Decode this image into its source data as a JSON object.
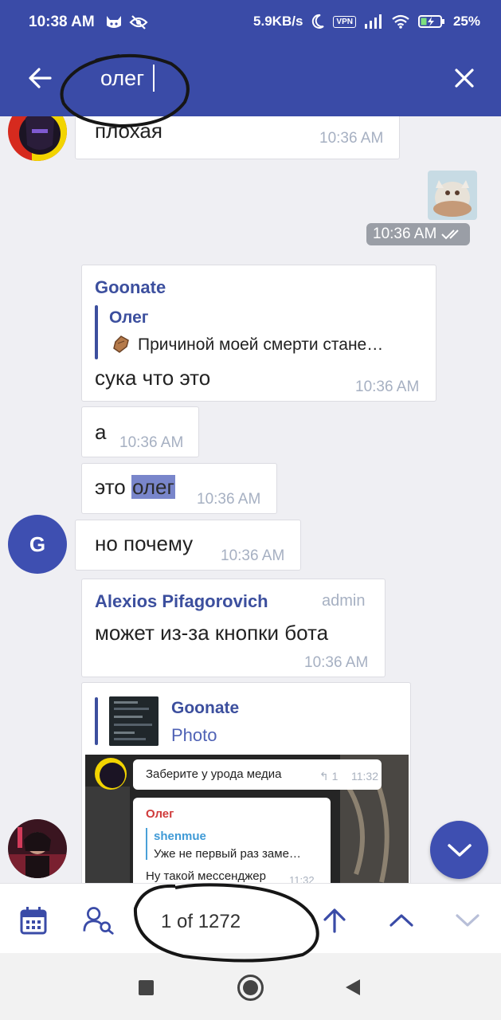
{
  "status_bar": {
    "time": "10:38 AM",
    "network_speed": "5.9KB/s",
    "vpn": "VPN",
    "battery": "25%"
  },
  "search": {
    "query": "олег"
  },
  "messages": {
    "m1": {
      "text": "плохая",
      "time": "10:36 AM"
    },
    "m2": {
      "time": "10:36 AM"
    },
    "m3": {
      "sender": "Goonate",
      "reply_name": "Олег",
      "reply_text": "Причиной моей смерти стане…",
      "text": "сука что это",
      "time": "10:36 AM"
    },
    "m4": {
      "text": "а",
      "time": "10:36 AM"
    },
    "m5": {
      "text_before": "это ",
      "highlight": "олег",
      "time": "10:36 AM"
    },
    "m6": {
      "avatar_letter": "G",
      "text": "но почему",
      "time": "10:36 AM"
    },
    "m7": {
      "sender": "Alexios Pifagorovich",
      "role": "admin",
      "text": "может из-за кнопки бота",
      "time": "10:36 AM"
    },
    "m8": {
      "reply_name": "Goonate",
      "reply_sub": "Photo",
      "photo": {
        "b1_text": "Заберите у урода медиа",
        "b1_reply_count": "1",
        "b1_time": "11:32",
        "b2_name": "Олег",
        "b2_reply_name": "shenmue",
        "b2_reply_text": "Уже не первый раз заме…",
        "b2_text": "Ну такой мессенджер",
        "b2_time": "11:32"
      }
    }
  },
  "bottom_bar": {
    "result_count": "1 of 1272"
  },
  "colors": {
    "primary": "#3a4ba7",
    "accent": "#3e4fb1",
    "chat_bg": "#efeff3",
    "highlight": "#7986cb"
  },
  "icons": {
    "back": "arrow-left-icon",
    "close": "close-icon",
    "calendar": "calendar-icon",
    "search_user": "user-search-icon",
    "arrow_up": "arrow-up-icon",
    "prev": "chevron-up-icon",
    "next": "chevron-down-icon",
    "scroll_down": "chevron-down-icon"
  }
}
